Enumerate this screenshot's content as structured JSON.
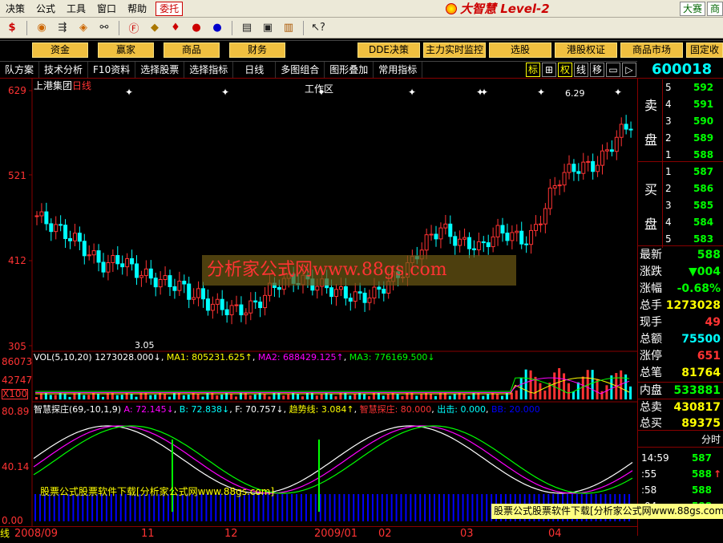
{
  "menu": {
    "items": [
      "决策",
      "公式",
      "工具",
      "窗口",
      "帮助"
    ],
    "weituo": "委托",
    "brand": "大智慧 Level-2",
    "right_buttons": [
      "大赛",
      "商"
    ]
  },
  "funcbar": {
    "buttons": [
      "资金",
      "赢家",
      "商品",
      "财务",
      "DDE决策",
      "主力实时监控",
      "选股",
      "港股权证",
      "商品市场",
      "固定收"
    ],
    "work_area": "工作区",
    "overlay": "股票公式软件下载|分析家公式网www.88gs.com"
  },
  "tabs": {
    "items": [
      "队方案",
      "技术分析",
      "F10资料",
      "选择股票",
      "选择指标",
      "日线",
      "多图组合",
      "图形叠加",
      "常用指标"
    ],
    "right_items": [
      "标",
      "权",
      "线",
      "移"
    ]
  },
  "stock": {
    "code": "600018",
    "name": "上港集团",
    "period": "日线"
  },
  "price_axis": [
    "629",
    "521",
    "412",
    "305"
  ],
  "high_mark": "6.29",
  "low_mark": "3.05",
  "vol_header": {
    "name": "VOL(5,10,20)",
    "value": "1273028.000↓",
    "ma1": "MA1: 805231.625↑",
    "ma2": "MA2: 688429.125↑",
    "ma3": "MA3: 776169.500↓"
  },
  "vol_axis": [
    "86073",
    "42747",
    "X100"
  ],
  "ind_header": {
    "name": "智慧探庄(69,-10,1,9)",
    "a": "A: 72.145↓",
    "b": "B: 72.838↓",
    "f": "F: 70.757↓",
    "trend": "趋势线: 3.084↑",
    "zhuang": "智慧探庄: 80.000",
    "out": "出击: 0.000",
    "bb": "BB: 20.000"
  },
  "ind_axis": [
    "80.89",
    "40.14",
    "0.00"
  ],
  "inner_ad": "股票公式股票软件下载[分析家公式网www.88gs.com]",
  "watermark": "分析家公式网www.88gs.com",
  "bottom_banner": "股票公式股票软件下载[分析家公式网www.88gs.com]",
  "dates": [
    "2008/09",
    "11",
    "12",
    "2009/01",
    "02",
    "03",
    "04"
  ],
  "date_left": "线",
  "orderbook": {
    "sell_label": "卖\n盘",
    "buy_label": "买\n盘",
    "sell": [
      {
        "i": "5",
        "p": "592"
      },
      {
        "i": "4",
        "p": "591"
      },
      {
        "i": "3",
        "p": "590"
      },
      {
        "i": "2",
        "p": "589"
      },
      {
        "i": "1",
        "p": "588"
      }
    ],
    "buy": [
      {
        "i": "1",
        "p": "587"
      },
      {
        "i": "2",
        "p": "586"
      },
      {
        "i": "3",
        "p": "585"
      },
      {
        "i": "4",
        "p": "584"
      },
      {
        "i": "5",
        "p": "583"
      }
    ]
  },
  "stats": [
    {
      "label": "最新",
      "value": "588",
      "color": "#0f0"
    },
    {
      "label": "涨跌",
      "value": "▼004",
      "color": "#0f0"
    },
    {
      "label": "涨幅",
      "value": "-0.68%",
      "color": "#0f0"
    },
    {
      "label": "总手",
      "value": "1273028",
      "color": "#ff0"
    },
    {
      "label": "现手",
      "value": "49",
      "color": "#f33"
    },
    {
      "label": "总额",
      "value": "75500",
      "color": "#0ff"
    },
    {
      "label": "涨停",
      "value": "651",
      "color": "#f33"
    },
    {
      "label": "总笔",
      "value": "81764",
      "color": "#ff0"
    },
    {
      "label": "内盘",
      "value": "533881",
      "color": "#0f0"
    },
    {
      "label": "总卖",
      "value": "430817",
      "color": "#ff0"
    },
    {
      "label": "总买",
      "value": "89375",
      "color": "#ff0"
    }
  ],
  "fenshi": "分时",
  "ticks": [
    {
      "t": "14:59",
      "p": "587",
      "d": ""
    },
    {
      "t": ":55",
      "p": "588",
      "d": "↑"
    },
    {
      "t": ":58",
      "p": "588",
      "d": ""
    },
    {
      "t": ":04",
      "p": "588",
      "d": ""
    }
  ],
  "colors": {
    "up": "#f33",
    "down": "#0ff",
    "accent": "#f0c040"
  }
}
